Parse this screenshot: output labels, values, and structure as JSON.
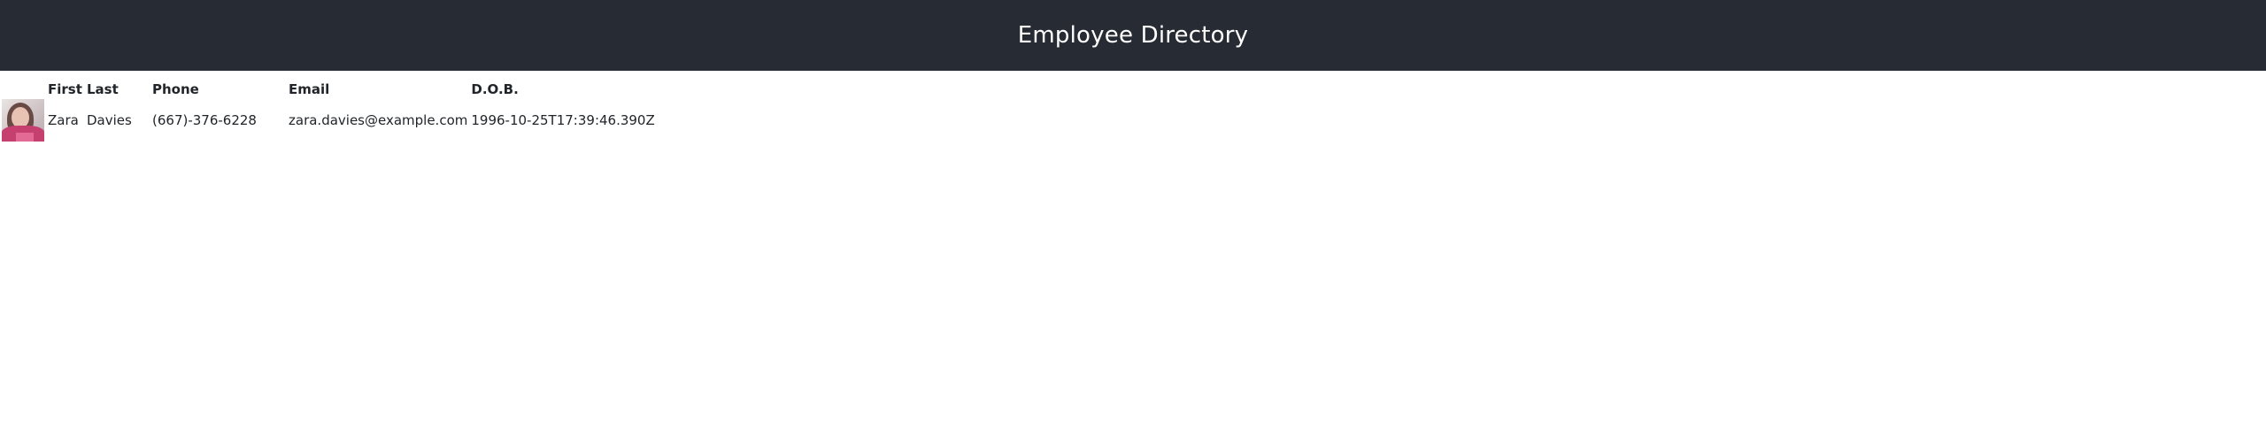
{
  "header": {
    "title": "Employee Directory"
  },
  "table": {
    "columns": [
      "",
      "First",
      "Last",
      "Phone",
      "Email",
      "D.O.B."
    ],
    "rows": [
      {
        "avatar_icon": "person-photo",
        "first": "Zara",
        "last": "Davies",
        "phone": "(667)-376-6228",
        "email": "zara.davies@example.com",
        "dob": "1996-10-25T17:39:46.390Z"
      }
    ]
  },
  "colors": {
    "navbar_bg": "#272b33",
    "navbar_text": "#ffffff"
  }
}
